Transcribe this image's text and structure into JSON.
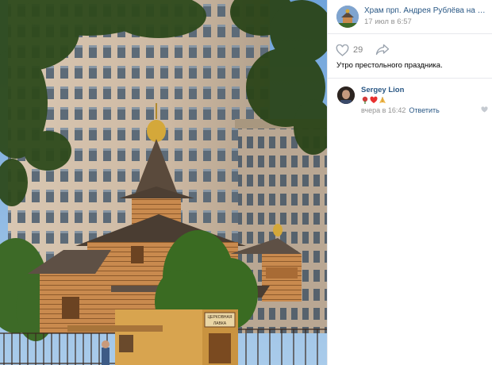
{
  "post": {
    "group_name": "Храм прп. Андрея Рублёва на Верх…",
    "date": "17 июл в 6:57",
    "likes": "29",
    "text": "Утро престольного праздника."
  },
  "comment": {
    "author": "Sergey Lion",
    "time": "вчера в 16:42",
    "reply_label": "Ответить"
  },
  "photo": {
    "sign_text_line1": "ЦЕРКОВНАЯ",
    "sign_text_line2": "ЛАВКА"
  },
  "colors": {
    "link": "#2a5885",
    "meta": "#939393",
    "divider": "#e7e8ec",
    "sky": "#8ab6e0",
    "building": "#c9b8a6",
    "wood": "#c98a4e"
  },
  "icons": {
    "like": "heart-outline-icon",
    "share": "share-arrow-icon",
    "comment_like": "heart-small-icon"
  }
}
